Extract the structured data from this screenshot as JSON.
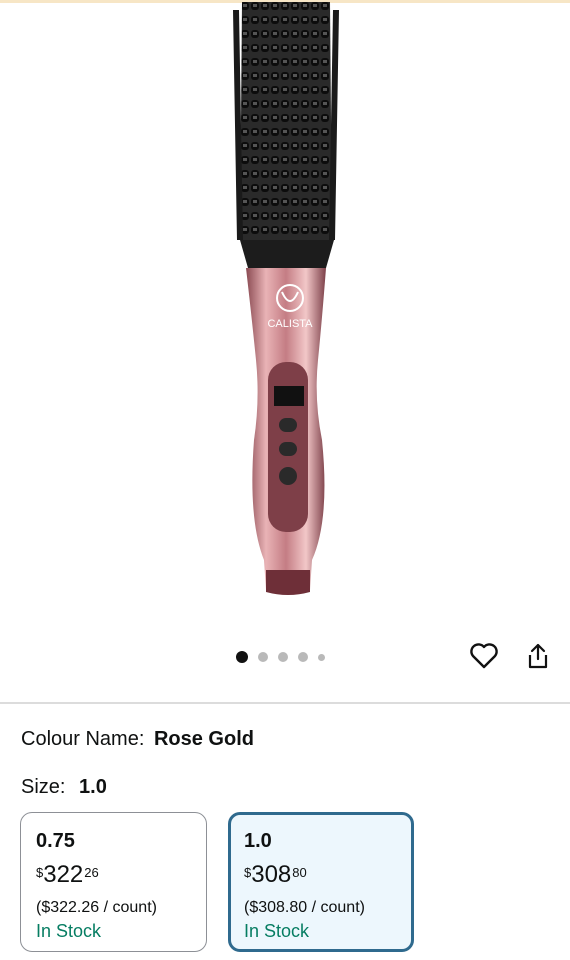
{
  "gallery": {
    "image_icon": "curling-brush-product-image",
    "brand_mark": "CALISTA",
    "dots_total": 5,
    "active_dot": 1,
    "wishlist_icon": "heart-icon",
    "share_icon": "share-icon"
  },
  "colour": {
    "label": "Colour Name:",
    "value": "Rose Gold"
  },
  "size": {
    "label": "Size:",
    "value": "1.0"
  },
  "variants": [
    {
      "size": "0.75",
      "currency": "$",
      "whole": "322",
      "fraction": "26",
      "per_unit": "($322.26 / count)",
      "stock": "In Stock",
      "selected": false
    },
    {
      "size": "1.0",
      "currency": "$",
      "whole": "308",
      "fraction": "80",
      "per_unit": "($308.80 / count)",
      "stock": "In Stock",
      "selected": true
    }
  ],
  "colors": {
    "stock_green": "#067d62",
    "selected_border": "#2f6a8e",
    "selected_bg": "#edf7fd"
  }
}
